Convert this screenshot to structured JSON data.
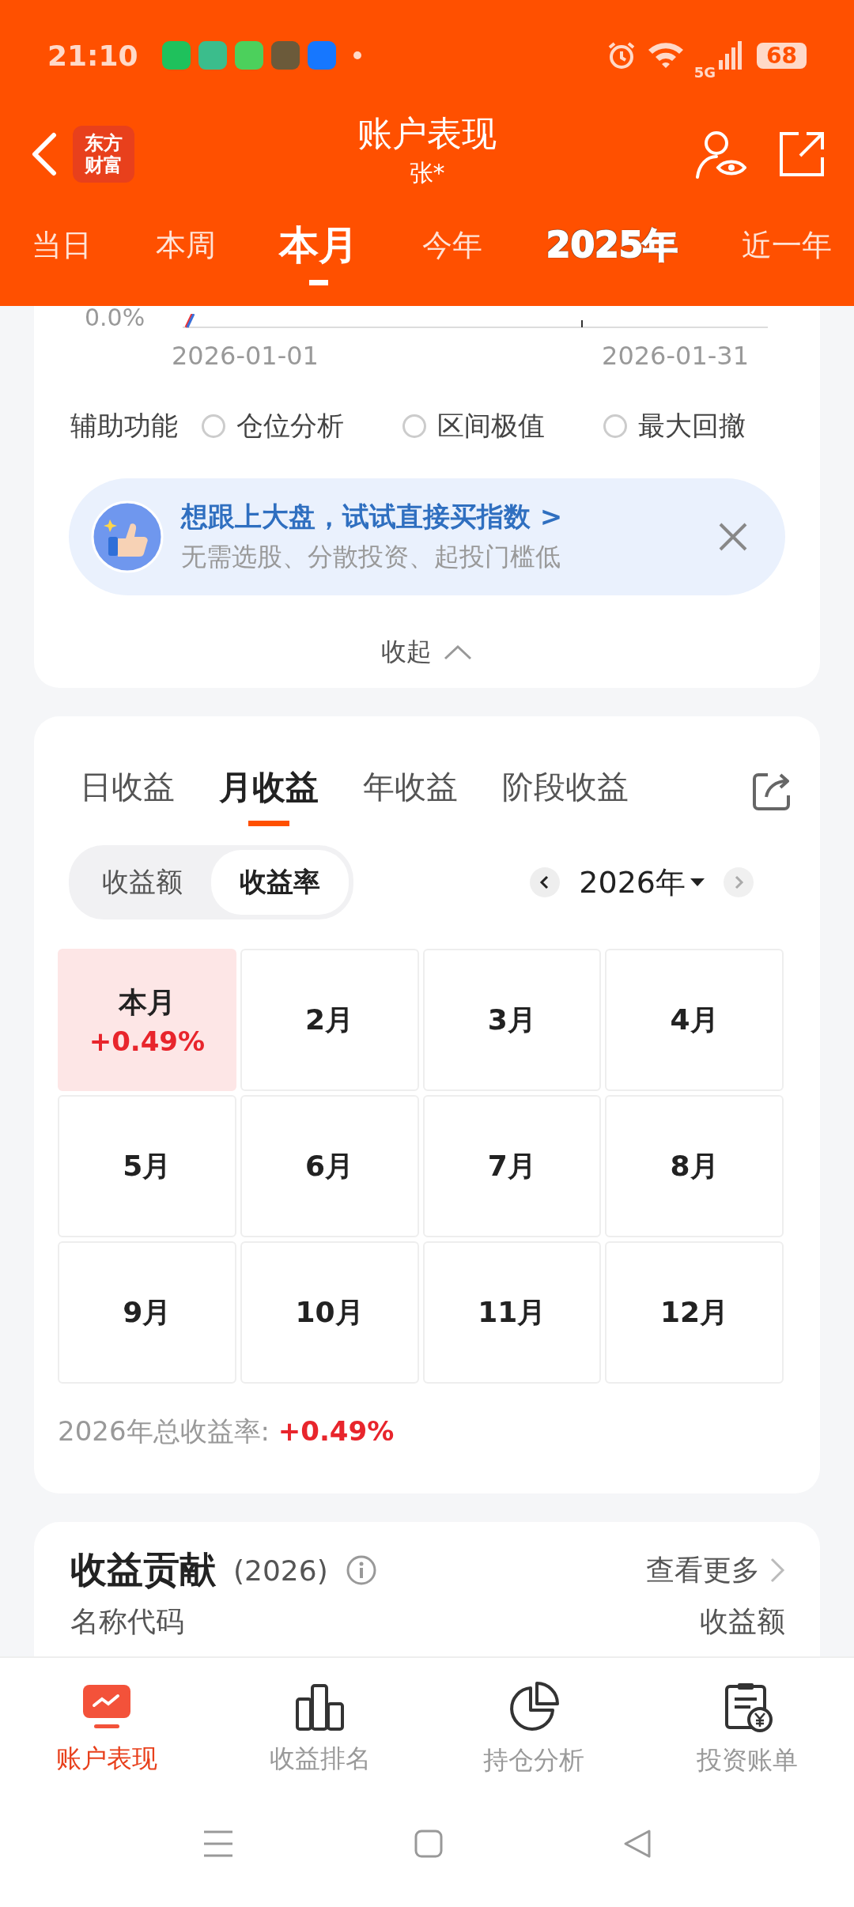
{
  "status_bar": {
    "time": "21:10",
    "network": "5G",
    "battery": "68"
  },
  "header": {
    "title": "账户表现",
    "subtitle": "张*",
    "logo": "东方财富"
  },
  "period_tabs": [
    {
      "label": "当日",
      "selected": false,
      "kind": "plain"
    },
    {
      "label": "本周",
      "selected": false,
      "kind": "plain"
    },
    {
      "label": "本月",
      "selected": true,
      "kind": "plain"
    },
    {
      "label": "今年",
      "selected": false,
      "kind": "plain"
    },
    {
      "label": "2025年",
      "selected": false,
      "kind": "outlined"
    },
    {
      "label": "近一年",
      "selected": false,
      "kind": "plain"
    }
  ],
  "chart": {
    "y_label": "0.0%",
    "x_labels": [
      "2026-01-01",
      "2026-01-31"
    ]
  },
  "assist": {
    "label": "辅助功能",
    "options": [
      {
        "label": "仓位分析",
        "checked": false
      },
      {
        "label": "区间极值",
        "checked": false
      },
      {
        "label": "最大回撤",
        "checked": false
      }
    ]
  },
  "banner": {
    "title": "想跟上大盘，试试直接买指数 >",
    "subtitle": "无需选股、分散投资、起投门槛低"
  },
  "collapse": "收起",
  "returns": {
    "tabs": [
      {
        "label": "日收益",
        "selected": false
      },
      {
        "label": "月收益",
        "selected": true
      },
      {
        "label": "年收益",
        "selected": false
      },
      {
        "label": "阶段收益",
        "selected": false
      }
    ],
    "toggle": [
      {
        "label": "收益额",
        "selected": false
      },
      {
        "label": "收益率",
        "selected": true
      }
    ],
    "year": "2026年",
    "months": [
      {
        "label": "本月",
        "value": "+0.49%",
        "selected": true
      },
      {
        "label": "2月",
        "selected": false
      },
      {
        "label": "3月",
        "selected": false
      },
      {
        "label": "4月",
        "selected": false
      },
      {
        "label": "5月",
        "selected": false
      },
      {
        "label": "6月",
        "selected": false
      },
      {
        "label": "7月",
        "selected": false
      },
      {
        "label": "8月",
        "selected": false
      },
      {
        "label": "9月",
        "selected": false
      },
      {
        "label": "10月",
        "selected": false
      },
      {
        "label": "11月",
        "selected": false
      },
      {
        "label": "12月",
        "selected": false
      }
    ],
    "total_label": "2026年总收益率:",
    "total_value": "+0.49%"
  },
  "contribution": {
    "title": "收益贡献",
    "year": "(2026)",
    "more": "查看更多",
    "columns": [
      "名称代码",
      "收益额"
    ]
  },
  "bottom_nav": [
    {
      "label": "账户表现",
      "selected": true,
      "kind": "monitor"
    },
    {
      "label": "收益排名",
      "selected": false,
      "kind": "bars"
    },
    {
      "label": "持仓分析",
      "selected": false,
      "kind": "pie"
    },
    {
      "label": "投资账单",
      "selected": false,
      "kind": "bill"
    }
  ]
}
